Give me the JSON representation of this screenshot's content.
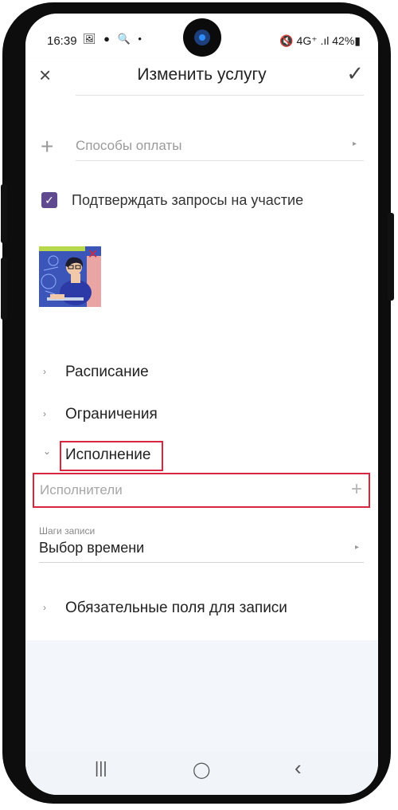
{
  "status_bar": {
    "time": "16:39",
    "left_icons": "🖼 ● 🔍 •",
    "right_text": "🔇 4G⁺ .ıl 42%▮"
  },
  "app_bar": {
    "close_icon": "×",
    "title": "Изменить услугу",
    "confirm_icon": "✓"
  },
  "payment": {
    "plus_icon": "+",
    "label": "Способы оплаты",
    "arrow_icon": "▸"
  },
  "confirm_requests": {
    "checked": true,
    "check_glyph": "✓",
    "label": "Подтверждать запросы на участие"
  },
  "image": {
    "remove_icon": "✕"
  },
  "sections": {
    "schedule": {
      "chevron": "›",
      "label": "Расписание"
    },
    "limits": {
      "chevron": "›",
      "label": "Ограничения"
    },
    "execution": {
      "chevron": "⌄",
      "label": "Исполнение",
      "expanded": true
    }
  },
  "performers": {
    "placeholder": "Исполнители",
    "add_icon": "+"
  },
  "booking_steps": {
    "label": "Шаги записи",
    "value": "Выбор времени",
    "arrow_icon": "▸"
  },
  "required_fields": {
    "chevron": "›",
    "label": "Обязательные поля для записи"
  },
  "nav_bar": {
    "recents": "|||",
    "home": "◯",
    "back": "‹"
  },
  "colors": {
    "accent_checkbox": "#5f4a8f",
    "highlight": "#d7263d"
  }
}
